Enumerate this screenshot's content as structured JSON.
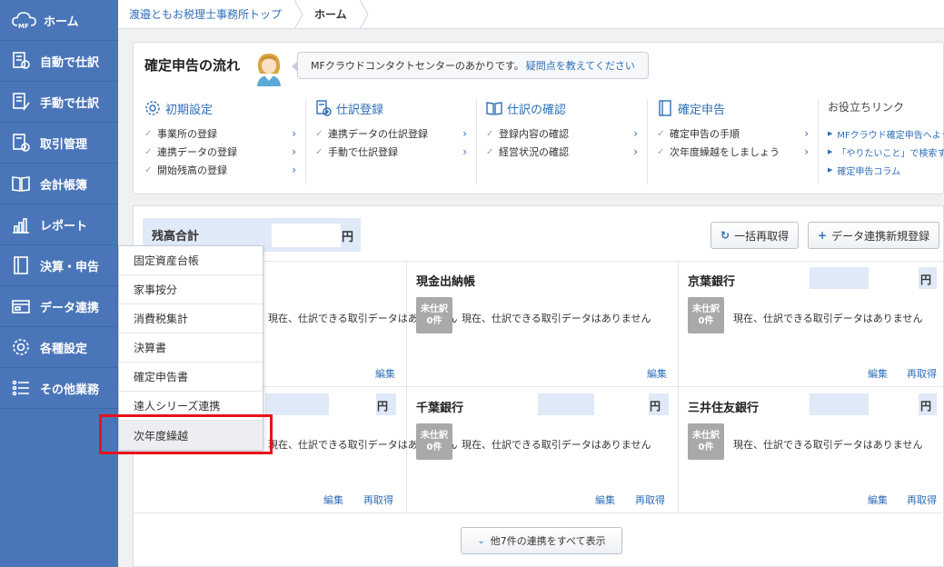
{
  "sidebar": {
    "items": [
      {
        "label": "ホーム",
        "icon": "cloud-mf-icon",
        "logo_text": "MF"
      },
      {
        "label": "自動で仕訳",
        "icon": "auto-journal-icon"
      },
      {
        "label": "手動で仕訳",
        "icon": "manual-journal-icon"
      },
      {
        "label": "取引管理",
        "icon": "transaction-icon"
      },
      {
        "label": "会計帳簿",
        "icon": "book-icon"
      },
      {
        "label": "レポート",
        "icon": "chart-icon"
      },
      {
        "label": "決算・申告",
        "icon": "settlement-icon"
      },
      {
        "label": "データ連携",
        "icon": "data-link-icon"
      },
      {
        "label": "各種設定",
        "icon": "gear-icon"
      },
      {
        "label": "その他業務",
        "icon": "list-icon"
      }
    ]
  },
  "breadcrumb": {
    "items": [
      "渡邉ともお税理士事務所トップ",
      "ホーム"
    ]
  },
  "flow": {
    "title": "確定申告の流れ",
    "bubble_text": "MFクラウドコンタクトセンターのあかりです。",
    "bubble_link": "疑問点を教えてください",
    "columns": [
      {
        "title": "初期設定",
        "icon": "gear-icon",
        "items": [
          "事業所の登録",
          "連携データの登録",
          "開始残高の登録"
        ]
      },
      {
        "title": "仕訳登録",
        "icon": "journal-add-icon",
        "items": [
          "連携データの仕訳登録",
          "手動で仕訳登録"
        ]
      },
      {
        "title": "仕訳の確認",
        "icon": "book-icon",
        "items": [
          "登録内容の確認",
          "経営状況の確認"
        ]
      },
      {
        "title": "確定申告",
        "icon": "settlement-icon",
        "items": [
          "確定申告の手順",
          "次年度繰越をしましょう"
        ]
      }
    ],
    "links": {
      "title": "お役立ちリンク",
      "items": [
        "MFクラウド確定申告へようこそ",
        "「やりたいこと」で検索する",
        "確定申告コラム"
      ]
    }
  },
  "bank": {
    "balance_label": "残高合計",
    "yen": "円",
    "refresh_all": "一括再取得",
    "add_link": "データ連携新規登録",
    "badge_line1": "未仕訳",
    "badge_line2": "0件",
    "message": "現在、仕訳できる取引データはありません",
    "edit": "編集",
    "refetch": "再取得",
    "cards": [
      {
        "title": ""
      },
      {
        "title": "現金出納帳"
      },
      {
        "title": "京葉銀行"
      },
      {
        "title": ""
      },
      {
        "title": "千葉銀行"
      },
      {
        "title": "三井住友銀行"
      }
    ],
    "show_more": "他7件の連携をすべて表示"
  },
  "menu": {
    "items": [
      "固定資産台帳",
      "家事按分",
      "消費税集計",
      "決算書",
      "確定申告書",
      "達人シリーズ連携",
      "次年度繰越"
    ]
  },
  "colors": {
    "sidebar": "#4a76b9",
    "link": "#2f6fb7",
    "highlight": "#e8121a"
  }
}
